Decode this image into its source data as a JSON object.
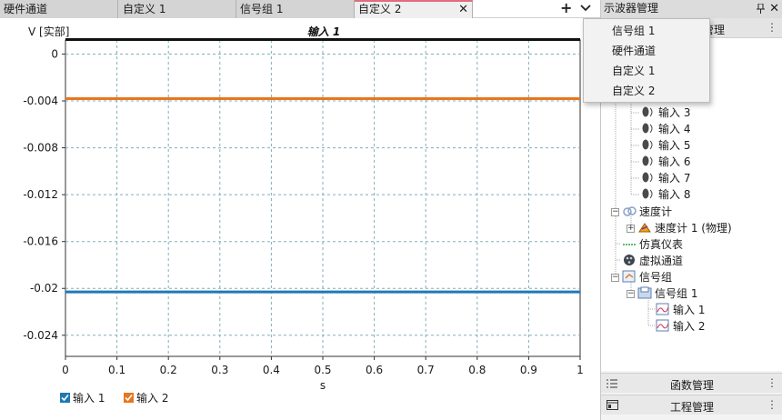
{
  "tabs": [
    {
      "label": "硬件通道"
    },
    {
      "label": "自定义 1"
    },
    {
      "label": "信号组 1"
    },
    {
      "label": "自定义 2",
      "active": true
    }
  ],
  "tab_bar": {
    "add_icon": "plus-icon",
    "menu_icon": "chevron-down-icon",
    "close_icon": "close-icon"
  },
  "chart": {
    "title": "输入 1",
    "y_unit": "V [实部]",
    "x_label": "s"
  },
  "chart_data": {
    "type": "line",
    "title": "输入 1",
    "xlabel": "s",
    "ylabel": "V [实部]",
    "xlim": [
      0,
      1
    ],
    "ylim": [
      -0.0258,
      0.0012
    ],
    "xticks": [
      "0",
      "0.1",
      "0.2",
      "0.3",
      "0.4",
      "0.5",
      "0.6",
      "0.7",
      "0.8",
      "0.9",
      "1"
    ],
    "yticks": [
      "0",
      "-0.004",
      "-0.008",
      "-0.012",
      "-0.016",
      "-0.02",
      "-0.024"
    ],
    "grid": true,
    "series": [
      {
        "name": "输入 2",
        "color": "#e8761e",
        "x": [
          0,
          1
        ],
        "values": [
          -0.0038,
          -0.0038
        ]
      },
      {
        "name": "输入 1",
        "color": "#1f78b4",
        "x": [
          0,
          1
        ],
        "values": [
          -0.0203,
          -0.0203
        ]
      }
    ]
  },
  "legend": [
    {
      "label": "输入 1",
      "color": "#1f78b4",
      "checked": true
    },
    {
      "label": "输入 2",
      "color": "#e8761e",
      "checked": true
    }
  ],
  "dropdown": {
    "items": [
      "信号组 1",
      "硬件通道",
      "自定义 1",
      "自定义 2"
    ]
  },
  "panel": {
    "title": "示波器管理",
    "section_label": "管理",
    "tree": [
      {
        "label": "输入 3",
        "icon": "sensor-icon"
      },
      {
        "label": "输入 4",
        "icon": "sensor-icon"
      },
      {
        "label": "输入 5",
        "icon": "sensor-icon"
      },
      {
        "label": "输入 6",
        "icon": "sensor-icon"
      },
      {
        "label": "输入 7",
        "icon": "sensor-icon"
      },
      {
        "label": "输入 8",
        "icon": "sensor-icon"
      },
      {
        "label": "速度计",
        "icon": "speedometer-icon"
      },
      {
        "label": "速度计 1 (物理)",
        "icon": "speed-sensor-icon"
      },
      {
        "label": "仿真仪表",
        "icon": "simulation-icon"
      },
      {
        "label": "虚拟通道",
        "icon": "virtual-channel-icon"
      },
      {
        "label": "信号组",
        "icon": "signal-group-icon"
      },
      {
        "label": "信号组 1",
        "icon": "signal-group-folder-icon"
      },
      {
        "label": "输入 1",
        "icon": "waveform-icon"
      },
      {
        "label": "输入 2",
        "icon": "waveform-icon"
      }
    ],
    "bottom_bars": [
      {
        "label": "函数管理",
        "icon": "list-icon"
      },
      {
        "label": "工程管理",
        "icon": "project-icon"
      }
    ]
  }
}
